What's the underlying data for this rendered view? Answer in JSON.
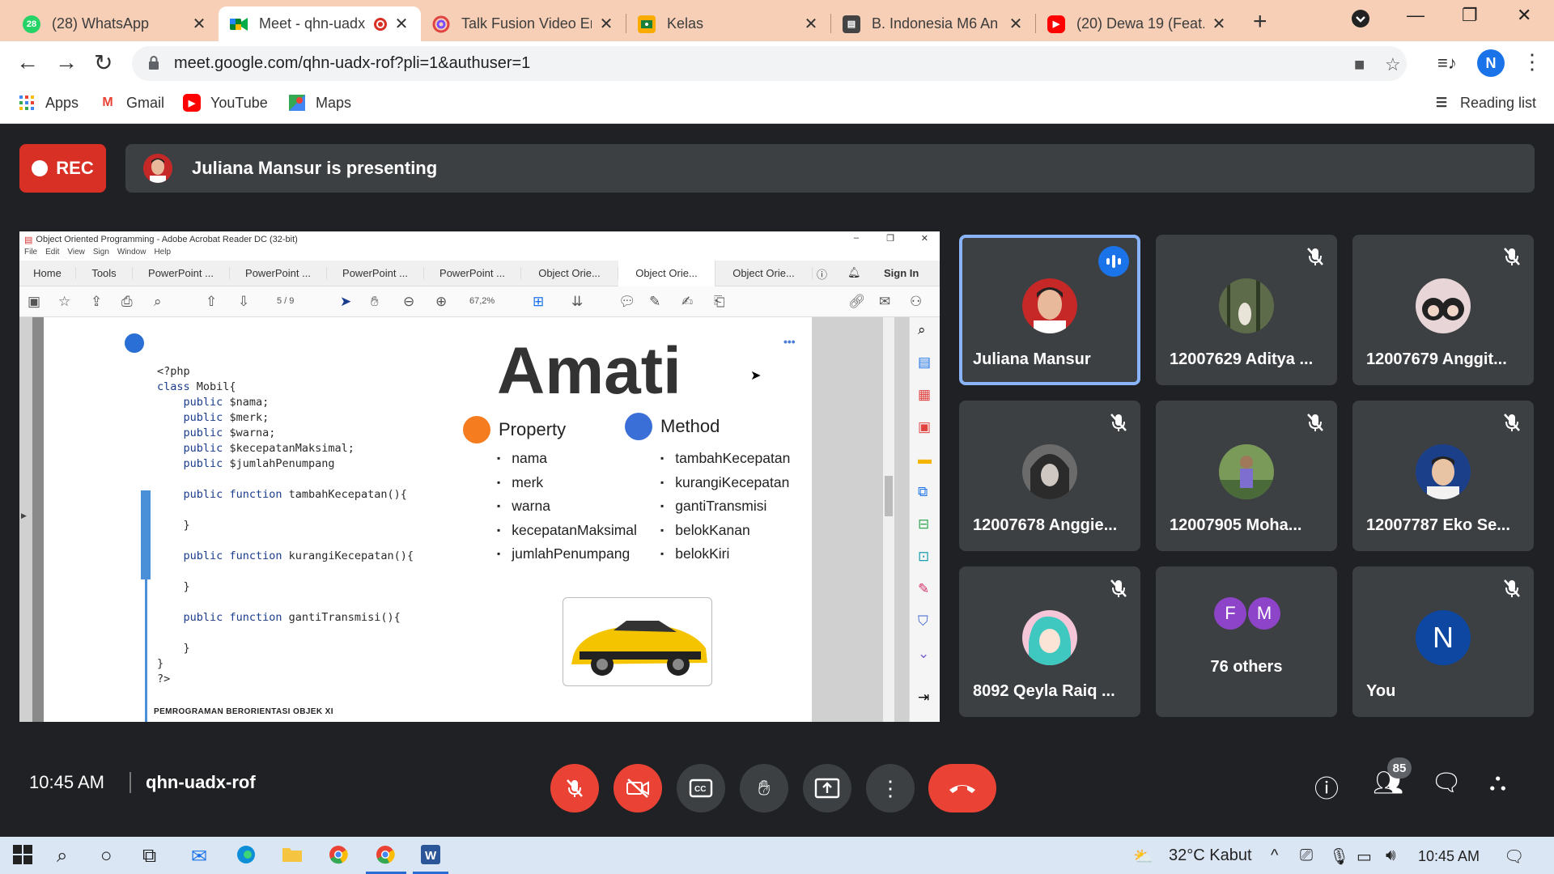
{
  "browser": {
    "tabs": [
      {
        "title": "(28) WhatsApp",
        "favicon": "whatsapp-icon",
        "badge": "28",
        "active": false
      },
      {
        "title": "Meet - qhn-uadx",
        "favicon": "google-meet-icon",
        "active": true,
        "recording": true
      },
      {
        "title": "Talk Fusion Video Email",
        "favicon": "talk-fusion-icon",
        "active": false
      },
      {
        "title": "Kelas",
        "favicon": "google-classroom-icon",
        "active": false
      },
      {
        "title": "B. Indonesia M6 An",
        "favicon": "classroom-assignment-icon",
        "active": false
      },
      {
        "title": "(20) Dewa 19 (Feat.",
        "favicon": "youtube-icon",
        "active": false
      }
    ],
    "url": "meet.google.com/qhn-uadx-rof?pli=1&authuser=1",
    "profile_initial": "N",
    "bookmarks": [
      {
        "label": "Apps",
        "icon": "apps-grid-icon"
      },
      {
        "label": "Gmail",
        "icon": "gmail-icon"
      },
      {
        "label": "YouTube",
        "icon": "youtube-icon"
      },
      {
        "label": "Maps",
        "icon": "maps-icon"
      }
    ],
    "reading_list": "Reading list"
  },
  "meet": {
    "rec_label": "REC",
    "presenting_text": "Juliana Mansur is presenting",
    "time": "10:45 AM",
    "meeting_code": "qhn-uadx-rof",
    "participant_count": "85",
    "participants": [
      {
        "name": "Juliana Mansur",
        "speaking": true,
        "muted": false
      },
      {
        "name": "12007629 Aditya ...",
        "muted": true
      },
      {
        "name": "12007679 Anggit...",
        "muted": true
      },
      {
        "name": "12007678 Anggie...",
        "muted": true
      },
      {
        "name": "12007905 Moha...",
        "muted": true
      },
      {
        "name": "12007787 Eko Se...",
        "muted": true
      },
      {
        "name": "8092 Qeyla Raiq ...",
        "muted": true
      },
      {
        "name": "76 others",
        "initials": [
          "F",
          "M"
        ]
      },
      {
        "name": "You",
        "initial": "N",
        "muted": true
      }
    ],
    "colors": {
      "accent": "#1a73e8",
      "danger": "#ea4335",
      "tile": "#3c4043",
      "bg": "#202124"
    }
  },
  "presentation": {
    "window_title": "Object Oriented Programming - Adobe Acrobat Reader DC (32-bit)",
    "menu": [
      "File",
      "Edit",
      "View",
      "Sign",
      "Window",
      "Help"
    ],
    "tabs": [
      "Home",
      "Tools",
      "PowerPoint ...",
      "PowerPoint ...",
      "PowerPoint ...",
      "PowerPoint ...",
      "Object Orie...",
      "Object Orie...",
      "Object Orie..."
    ],
    "sign_in": "Sign In",
    "page_indicator": "5 / 9",
    "zoom": "67,2%",
    "heading": "Amati",
    "code_lines": [
      "<?php",
      "class Mobil{",
      "    public $nama;",
      "    public $merk;",
      "    public $warna;",
      "    public $kecepatanMaksimal;",
      "    public $jumlahPenumpang",
      "",
      "    public function tambahKecepatan(){",
      "",
      "    }",
      "",
      "    public function kurangiKecepatan(){",
      "",
      "    }",
      "",
      "    public function gantiTransmisi(){",
      "",
      "    }",
      "}",
      "?>"
    ],
    "property_title": "Property",
    "property_items": [
      "nama",
      "merk",
      "warna",
      "kecepatanMaksimal",
      "jumlahPenumpang"
    ],
    "method_title": "Method",
    "method_items": [
      "tambahKecepatan",
      "kurangiKecepatan",
      "gantiTransmisi",
      "belokKanan",
      "belokKiri"
    ],
    "footer": "PEMROGRAMAN BERORIENTASI OBJEK XI"
  },
  "taskbar": {
    "weather": "32°C  Kabut",
    "time": "10:45 AM"
  }
}
